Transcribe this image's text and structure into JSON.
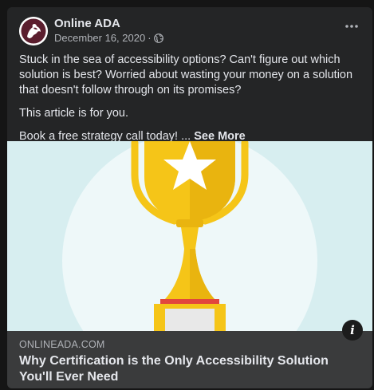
{
  "post": {
    "author": "Online ADA",
    "date": "December 16, 2020",
    "separator": "·",
    "audience_icon": "globe-icon",
    "more_icon": "more-horizontal-icon",
    "text": {
      "paragraph_1": "Stuck in the sea of accessibility options? Can't figure out which solution is best? Worried about wasting your money on a solution that doesn't follow through on its promises?",
      "paragraph_2": "This article is for you.",
      "paragraph_3": "Book a free strategy call today! ...",
      "see_more": "See More"
    }
  },
  "link_preview": {
    "image_icon": "trophy-star-illustration",
    "info_icon": "info-icon",
    "info_glyph": "i",
    "domain": "ONLINEADA.COM",
    "title": "Why Certification is the Only Accessibility Solution You'll Ever Need"
  },
  "colors": {
    "card_background": "#242526",
    "text_primary": "#e4e6eb",
    "text_secondary": "#b0b3b8",
    "link_box_background": "#3a3b3c",
    "image_background": "#d7eef0",
    "trophy_gold": "#f5c518"
  }
}
